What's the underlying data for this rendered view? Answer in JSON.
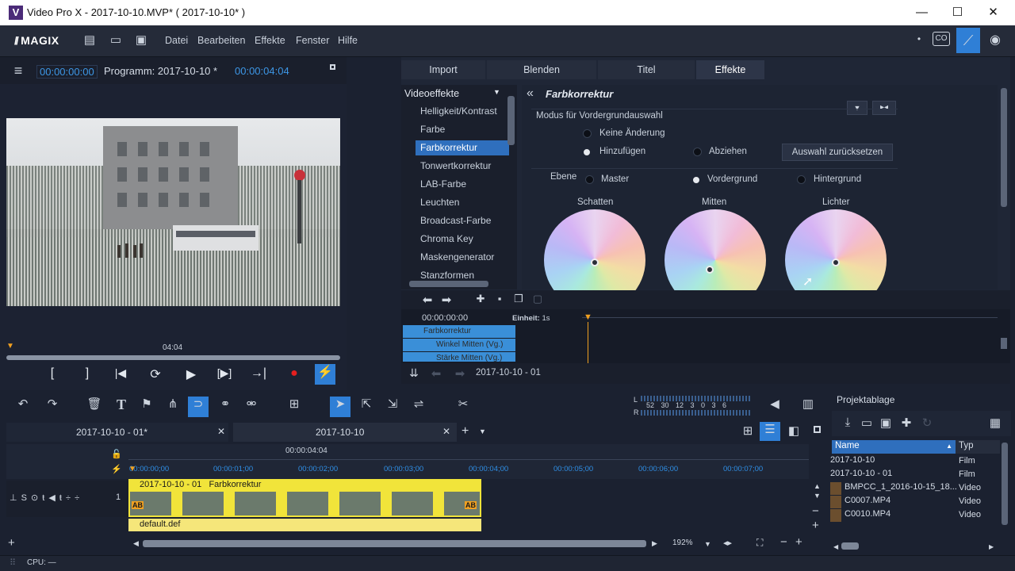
{
  "window": {
    "title": "Video Pro X - 2017-10-10.MVP* ( 2017-10-10* )",
    "logo": "V",
    "minimize": "—",
    "maximize": "☐",
    "close": "✕"
  },
  "menubar": {
    "brand": "MAGIX",
    "items": [
      "Datei",
      "Bearbeiten",
      "Effekte",
      "Fenster",
      "Hilfe"
    ]
  },
  "preview": {
    "menu_icon": "≡",
    "timecode_left": "00:00:00:00",
    "program_label": "Programm: 2017-10-10 *",
    "timecode_right": "00:00:04:04",
    "scrub_time": "04:04",
    "controls": [
      "[",
      "]",
      "|◀",
      "⟳",
      "▶",
      "[▶]",
      "→|",
      "●",
      "⚡"
    ]
  },
  "effects": {
    "tabs": [
      "Import",
      "Blenden",
      "Titel",
      "Effekte"
    ],
    "active_tab": "Effekte",
    "category": "Videoeffekte",
    "list": [
      "Helligkeit/Kontrast",
      "Farbe",
      "Farbkorrektur",
      "Tonwertkorrektur",
      "LAB-Farbe",
      "Leuchten",
      "Broadcast-Farbe",
      "Chroma Key",
      "Maskengenerator",
      "Stanzformen"
    ],
    "selected": "Farbkorrektur",
    "panel_title": "Farbkorrektur",
    "back_icon": "«",
    "mode_label": "Modus für Vordergrundauswahl",
    "modes": [
      "Keine Änderung",
      "Hinzufügen",
      "Abziehen"
    ],
    "reset_button": "Auswahl zurücksetzen",
    "layer_label": "Ebene",
    "layers": [
      "Master",
      "Vordergrund",
      "Hintergrund"
    ],
    "wheels": [
      "Schatten",
      "Mitten",
      "Lichter"
    ]
  },
  "keyframes": {
    "timecode": "00:00:00:00",
    "unit_label": "Einheit:",
    "unit_value": "1s",
    "rows": [
      "Farbkorrektur",
      "Winkel Mitten (Vg.)",
      "Stärke Mitten (Vg.)"
    ],
    "nav_label": "2017-10-10 - 01"
  },
  "timeline": {
    "tabs": [
      "2017-10-10 - 01*",
      "2017-10-10"
    ],
    "close_icon": "✕",
    "add_icon": "+",
    "position": "00:00:04:04",
    "ruler": [
      "00:00:00;00",
      "00:00:01;00",
      "00:00:02;00",
      "00:00:03;00",
      "00:00:04;00",
      "00:00:05;00",
      "00:00:06;00",
      "00:00:07;00"
    ],
    "clip_label": "2017-10-10 - 01   Farbkorrektur",
    "clip_badge": "AB",
    "audio_clip": "default.def",
    "track_num": "1",
    "track_ctrls": "⊥ S ⊙ ŧ ◀ ŧ ÷ ÷",
    "zoom": "192%",
    "meter_l": "L",
    "meter_r": "R",
    "meter_scale": "52 30 12 3 0 3 6"
  },
  "project": {
    "title": "Projektablage",
    "col_name": "Name",
    "col_type": "Typ",
    "rows": [
      {
        "name": "2017-10-10",
        "type": "Film"
      },
      {
        "name": "2017-10-10 - 01",
        "type": "Film"
      },
      {
        "name": "BMPCC_1_2016-10-15_18...",
        "type": "Video"
      },
      {
        "name": "C0007.MP4",
        "type": "Video"
      },
      {
        "name": "C0010.MP4",
        "type": "Video"
      }
    ]
  },
  "status": {
    "cpu": "CPU: —"
  }
}
